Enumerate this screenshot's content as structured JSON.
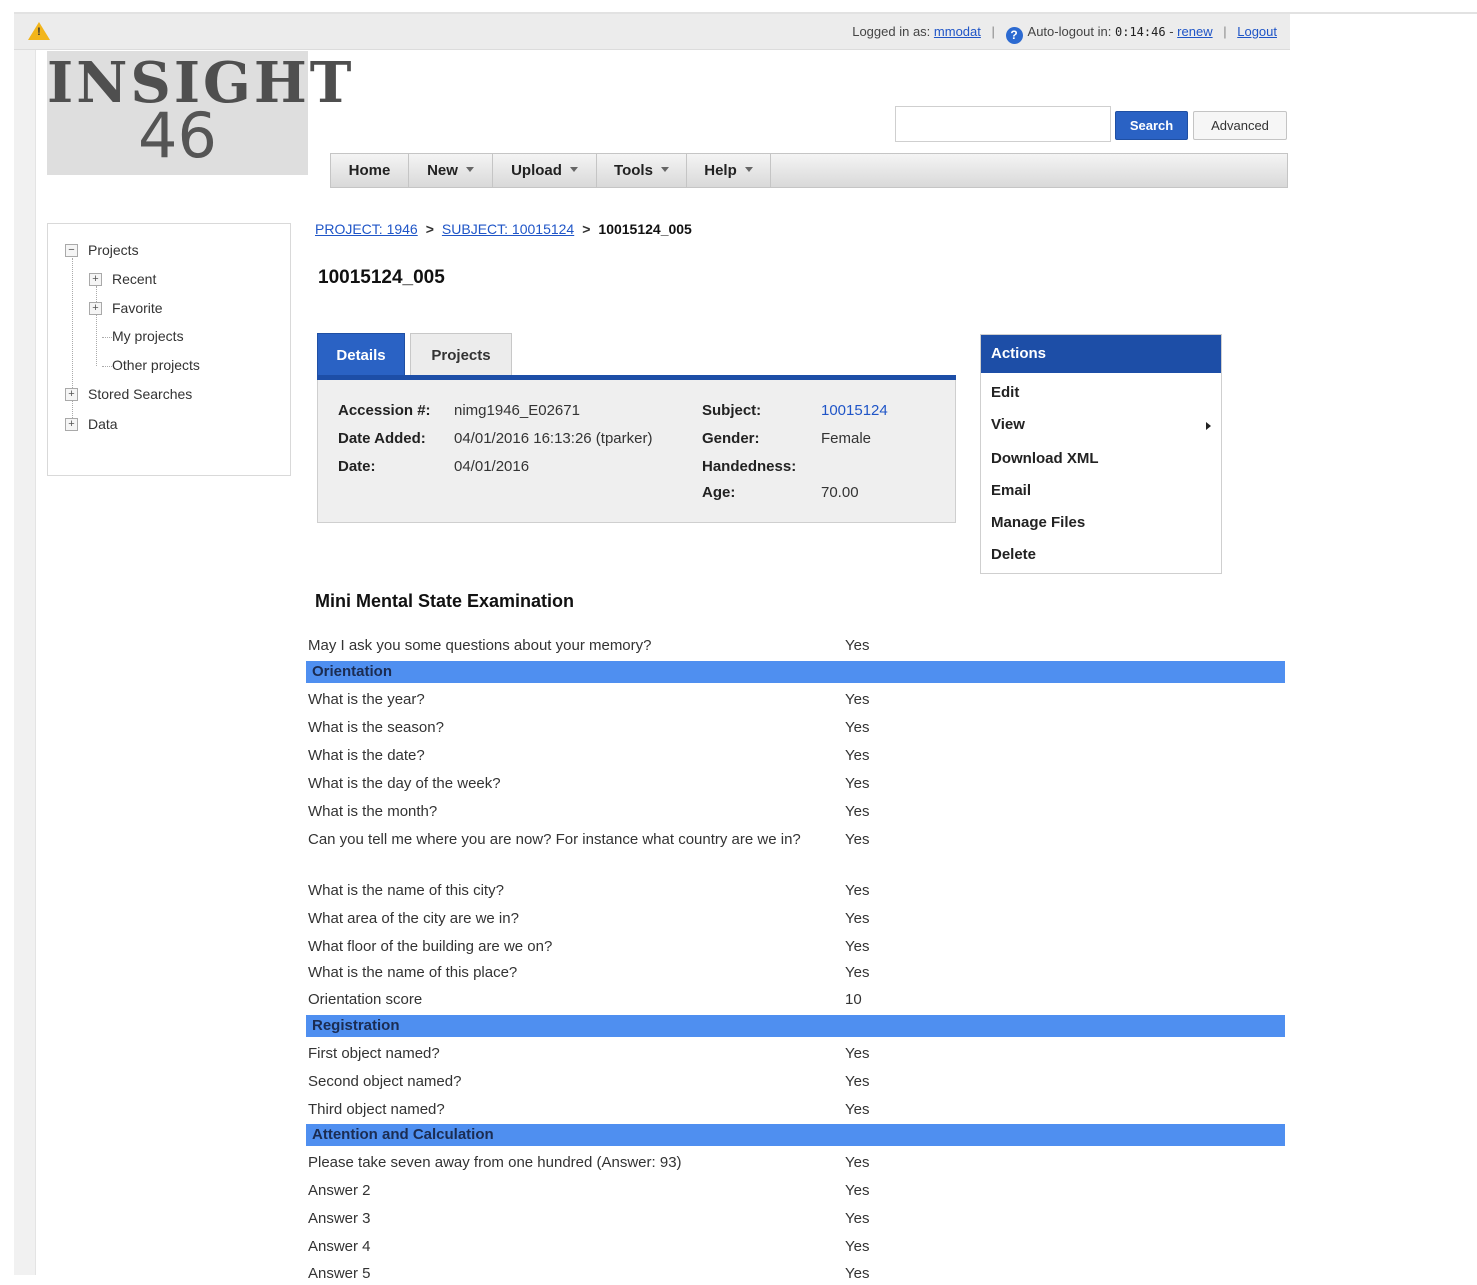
{
  "topbar": {
    "logged_in_label": "Logged in as:",
    "username": "mmodat",
    "autologout_label": "Auto-logout in:",
    "autologout_time": "0:14:46",
    "renew_label": "renew",
    "logout_label": "Logout"
  },
  "logo": {
    "line1": "INSIGHT",
    "line2": "46"
  },
  "search": {
    "value": "",
    "search_label": "Search",
    "advanced_label": "Advanced"
  },
  "nav": [
    {
      "label": "Home",
      "dropdown": false
    },
    {
      "label": "New",
      "dropdown": true
    },
    {
      "label": "Upload",
      "dropdown": true
    },
    {
      "label": "Tools",
      "dropdown": true
    },
    {
      "label": "Help",
      "dropdown": true
    }
  ],
  "tree": {
    "projects": "Projects",
    "recent": "Recent",
    "favorite": "Favorite",
    "my_projects": "My projects",
    "other_projects": "Other projects",
    "stored_searches": "Stored Searches",
    "data": "Data"
  },
  "breadcrumb": {
    "project": "PROJECT: 1946",
    "subject": "SUBJECT: 10015124",
    "current": "10015124_005"
  },
  "page_title": "10015124_005",
  "tabs": {
    "details": "Details",
    "projects": "Projects"
  },
  "details": {
    "accession_label": "Accession #:",
    "accession_value": "nimg1946_E02671",
    "date_added_label": "Date Added:",
    "date_added_value": "04/01/2016 16:13:26 (tparker)",
    "date_label": "Date:",
    "date_value": "04/01/2016",
    "subject_label": "Subject:",
    "subject_value": "10015124",
    "gender_label": "Gender:",
    "gender_value": "Female",
    "handedness_label": "Handedness:",
    "handedness_value": "",
    "age_label": "Age:",
    "age_value": "70.00"
  },
  "actions": {
    "title": "Actions",
    "edit": "Edit",
    "view": "View",
    "download_xml": "Download XML",
    "email": "Email",
    "manage_files": "Manage Files",
    "delete": "Delete"
  },
  "mmse": {
    "title": "Mini Mental State Examination",
    "intro_q": "May I ask you some questions about your memory?",
    "intro_a": "Yes",
    "orientation": {
      "heading": "Orientation",
      "rows": [
        {
          "q": "What is the year?",
          "a": "Yes"
        },
        {
          "q": "What is the season?",
          "a": "Yes"
        },
        {
          "q": "What is the date?",
          "a": "Yes"
        },
        {
          "q": "What is the day of the week?",
          "a": "Yes"
        },
        {
          "q": "What is the month?",
          "a": "Yes"
        },
        {
          "q": "Can you tell me where you are now? For instance what country are we in?",
          "a": "Yes"
        },
        {
          "q": "What is the name of this city?",
          "a": "Yes"
        },
        {
          "q": "What area of the city are we in?",
          "a": "Yes"
        },
        {
          "q": "What floor of the building are we on?",
          "a": "Yes"
        },
        {
          "q": "What is the name of this place?",
          "a": "Yes"
        },
        {
          "q": "Orientation score",
          "a": "10"
        }
      ]
    },
    "registration": {
      "heading": "Registration",
      "rows": [
        {
          "q": "First object named?",
          "a": "Yes"
        },
        {
          "q": "Second object named?",
          "a": "Yes"
        },
        {
          "q": "Third object named?",
          "a": "Yes"
        }
      ]
    },
    "attention": {
      "heading": "Attention and Calculation",
      "rows": [
        {
          "q": "Please take seven away from one hundred (Answer: 93)",
          "a": "Yes"
        },
        {
          "q": "Answer 2",
          "a": "Yes"
        },
        {
          "q": "Answer 3",
          "a": "Yes"
        },
        {
          "q": "Answer 4",
          "a": "Yes"
        },
        {
          "q": "Answer 5",
          "a": "Yes"
        }
      ]
    }
  }
}
